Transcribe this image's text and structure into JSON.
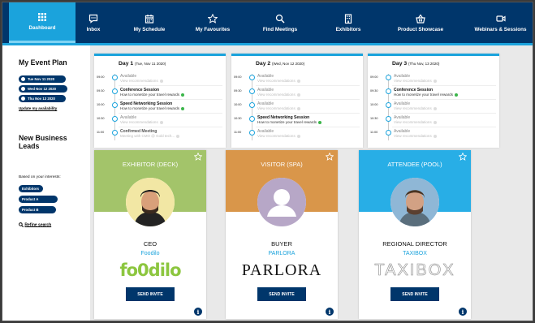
{
  "nav": {
    "items": [
      {
        "label": "Dashboard",
        "icon": "grid-icon",
        "active": true
      },
      {
        "label": "Inbox",
        "icon": "chat-icon"
      },
      {
        "label": "My Schedule",
        "icon": "calendar-icon"
      },
      {
        "label": "My Favourites",
        "icon": "star-icon"
      },
      {
        "label": "Find Meetings",
        "icon": "search-icon"
      },
      {
        "label": "Exhibitors",
        "icon": "building-icon"
      },
      {
        "label": "Product Showcase",
        "icon": "basket-icon"
      },
      {
        "label": "Webinars & Sessions",
        "icon": "video-icon"
      }
    ]
  },
  "event_plan": {
    "title": "My Event Plan",
    "dates": [
      "Tue Nov 11 2020",
      "Wed Nov 12 2020",
      "Thu Nov 13 2020"
    ],
    "update_link": "Update my availability"
  },
  "days": [
    {
      "day": "Day 1",
      "date": "(Tue, Nov 11 2020)",
      "slots": [
        {
          "time": "09:00",
          "title": "Available",
          "sub": "View recommendations",
          "busy": false
        },
        {
          "time": "09:30",
          "title": "Conference Session",
          "sub": "How to monetize your travel rewards",
          "busy": true
        },
        {
          "time": "10:00",
          "title": "Speed Networking Session",
          "sub": "How to monetize your travel rewards",
          "busy": true
        },
        {
          "time": "10:30",
          "title": "Available",
          "sub": "View recommendations",
          "busy": false
        },
        {
          "time": "11:00",
          "title": "Confirmed Meeting",
          "sub": "Meeting with CMO @ Gold tech...",
          "busy": false
        }
      ]
    },
    {
      "day": "Day 2",
      "date": "(Wed, Nov 12 2020)",
      "slots": [
        {
          "time": "09:00",
          "title": "Available",
          "sub": "View recommendations",
          "busy": false
        },
        {
          "time": "09:30",
          "title": "Available",
          "sub": "View recommendations",
          "busy": false
        },
        {
          "time": "10:00",
          "title": "Available",
          "sub": "View recommendations",
          "busy": false
        },
        {
          "time": "10:30",
          "title": "Speed Networking Session",
          "sub": "How to monetize your travel rewards",
          "busy": true
        },
        {
          "time": "11:00",
          "title": "Available",
          "sub": "View recommendations",
          "busy": false
        }
      ]
    },
    {
      "day": "Day 3",
      "date": "(Thu Nov, 13 2020)",
      "slots": [
        {
          "time": "09:00",
          "title": "Available",
          "sub": "View recommendations",
          "busy": false
        },
        {
          "time": "09:30",
          "title": "Conference Session",
          "sub": "How to monetize your travel rewards",
          "busy": true
        },
        {
          "time": "10:00",
          "title": "Available",
          "sub": "View recommendations",
          "busy": false
        },
        {
          "time": "10:30",
          "title": "Available",
          "sub": "View recommendations",
          "busy": false
        },
        {
          "time": "11:00",
          "title": "Available",
          "sub": "View recommendations",
          "busy": false
        }
      ]
    }
  ],
  "leads": {
    "title_line1": "New Business",
    "title_line2": "Leads",
    "subtitle": "Based on your interests:",
    "tags": [
      "Exhibitors",
      "Product A",
      "Product B"
    ],
    "refine": "Refine search",
    "cards": [
      {
        "type": "EXHIBITOR (DECK)",
        "color": "#a3c46a",
        "role": "CEO",
        "company": "Foodilo",
        "logo": "fo0dilo",
        "button": "SEND INVITE"
      },
      {
        "type": "VISITOR (SPA)",
        "color": "#d9964a",
        "role": "BUYER",
        "company": "PARLORA",
        "logo": "PARLORA",
        "button": "SEND INVITE"
      },
      {
        "type": "ATTENDEE (POOL)",
        "color": "#28aee6",
        "role": "REGIONAL DIRECTOR",
        "company": "TAXIBOX",
        "logo": "TAXIBOX",
        "button": "SEND INVITE"
      }
    ]
  },
  "colors": {
    "navy": "#00366b",
    "accent": "#1ba3dc",
    "green": "#3bb54a"
  }
}
